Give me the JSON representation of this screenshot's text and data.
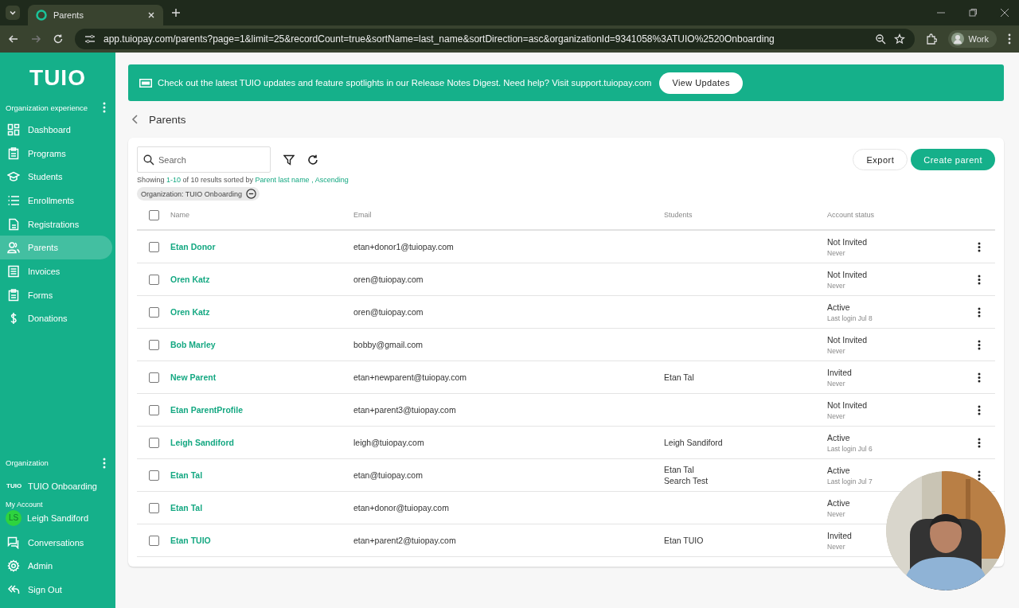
{
  "browser": {
    "tab_title": "Parents",
    "url": "app.tuiopay.com/parents?page=1&limit=25&recordCount=true&sortName=last_name&sortDirection=asc&organizationId=9341058%3ATUIO%2520Onboarding",
    "profile": "Work"
  },
  "sidebar": {
    "logo": "TUIO",
    "section_title": "Organization experience",
    "items": [
      {
        "label": "Dashboard",
        "selected": false
      },
      {
        "label": "Programs",
        "selected": false
      },
      {
        "label": "Students",
        "selected": false
      },
      {
        "label": "Enrollments",
        "selected": false
      },
      {
        "label": "Registrations",
        "selected": false
      },
      {
        "label": "Parents",
        "selected": true
      },
      {
        "label": "Invoices",
        "selected": false
      },
      {
        "label": "Forms",
        "selected": false
      },
      {
        "label": "Donations",
        "selected": false
      }
    ],
    "organization_title": "Organization",
    "org_badge": "TUIO",
    "organization": "TUIO Onboarding",
    "account_title": "My Account",
    "avatar_initials": "LS",
    "account_name": "Leigh Sandiford",
    "bottom_items": [
      {
        "label": "Conversations"
      },
      {
        "label": "Admin"
      },
      {
        "label": "Sign Out"
      }
    ]
  },
  "banner": {
    "text": "Check out the latest TUIO updates and feature spotlights in our Release Notes Digest. Need help? Visit support.tuiopay.com",
    "button": "View Updates"
  },
  "page_title": "Parents",
  "toolbar": {
    "search_placeholder": "Search",
    "export": "Export",
    "create": "Create parent"
  },
  "summary": {
    "prefix": "Showing",
    "range": "1-10",
    "middle": "of 10 results sorted by",
    "sort_field": "Parent last name ,",
    "sort_dir": "Ascending"
  },
  "filter_chip": "Organization: TUIO Onboarding",
  "table": {
    "all_checked": false,
    "columns": [
      "Name",
      "Email",
      "Students",
      "Account status"
    ],
    "rows": [
      {
        "name": "Etan Donor",
        "email": "etan+donor1@tuiopay.com",
        "students": [],
        "status": "Not Invited",
        "last_login": "Never",
        "checked": false
      },
      {
        "name": "Oren Katz",
        "email": "oren@tuiopay.com",
        "students": [],
        "status": "Not Invited",
        "last_login": "Never",
        "checked": false
      },
      {
        "name": "Oren Katz",
        "email": "oren@tuiopay.com",
        "students": [],
        "status": "Active",
        "last_login": "Last login Jul 8",
        "checked": false
      },
      {
        "name": "Bob Marley",
        "email": "bobby@gmail.com",
        "students": [],
        "status": "Not Invited",
        "last_login": "Never",
        "checked": false
      },
      {
        "name": "New Parent",
        "email": "etan+newparent@tuiopay.com",
        "students": [
          "Etan Tal"
        ],
        "status": "Invited",
        "last_login": "Never",
        "checked": false
      },
      {
        "name": "Etan ParentProfile",
        "email": "etan+parent3@tuiopay.com",
        "students": [],
        "status": "Not Invited",
        "last_login": "Never",
        "checked": false
      },
      {
        "name": "Leigh Sandiford",
        "email": "leigh@tuiopay.com",
        "students": [
          "Leigh Sandiford"
        ],
        "status": "Active",
        "last_login": "Last login Jul 6",
        "checked": false
      },
      {
        "name": "Etan Tal",
        "email": "etan@tuiopay.com",
        "students": [
          "Etan Tal",
          "Search Test"
        ],
        "status": "Active",
        "last_login": "Last login Jul 7",
        "checked": false
      },
      {
        "name": "Etan Tal",
        "email": "etan+donor@tuiopay.com",
        "students": [],
        "status": "Active",
        "last_login": "Never",
        "checked": false
      },
      {
        "name": "Etan TUIO",
        "email": "etan+parent2@tuiopay.com",
        "students": [
          "Etan TUIO"
        ],
        "status": "Invited",
        "last_login": "Never",
        "checked": false
      }
    ]
  }
}
